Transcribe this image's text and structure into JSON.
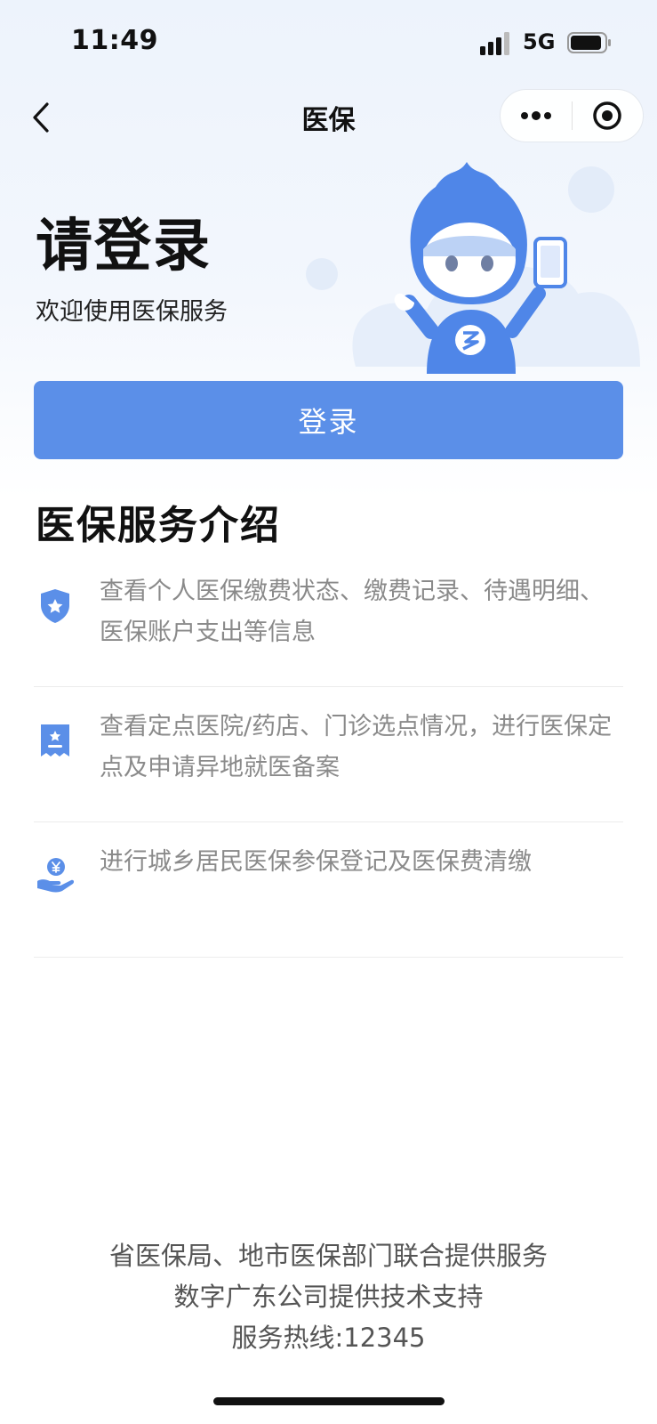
{
  "status_bar": {
    "time": "11:49",
    "network": "5G"
  },
  "nav": {
    "title": "医保"
  },
  "hero": {
    "title": "请登录",
    "subtitle": "欢迎使用医保服务"
  },
  "login_button": {
    "label": "登录"
  },
  "services": {
    "title": "医保服务介绍",
    "items": [
      {
        "icon": "shield-star-icon",
        "text": "查看个人医保缴费状态、缴费记录、待遇明细、医保账户支出等信息"
      },
      {
        "icon": "receipt-icon",
        "text": "查看定点医院/药店、门诊选点情况，进行医保定点及申请异地就医备案"
      },
      {
        "icon": "hand-coin-icon",
        "text": "进行城乡居民医保参保登记及医保费清缴"
      }
    ]
  },
  "footer": {
    "line1": "省医保局、地市医保部门联合提供服务",
    "line2": "数字广东公司提供技术支持",
    "line3": "服务热线:12345"
  },
  "colors": {
    "accent": "#5b8fe8",
    "icon_blue": "#5b8fe8"
  }
}
